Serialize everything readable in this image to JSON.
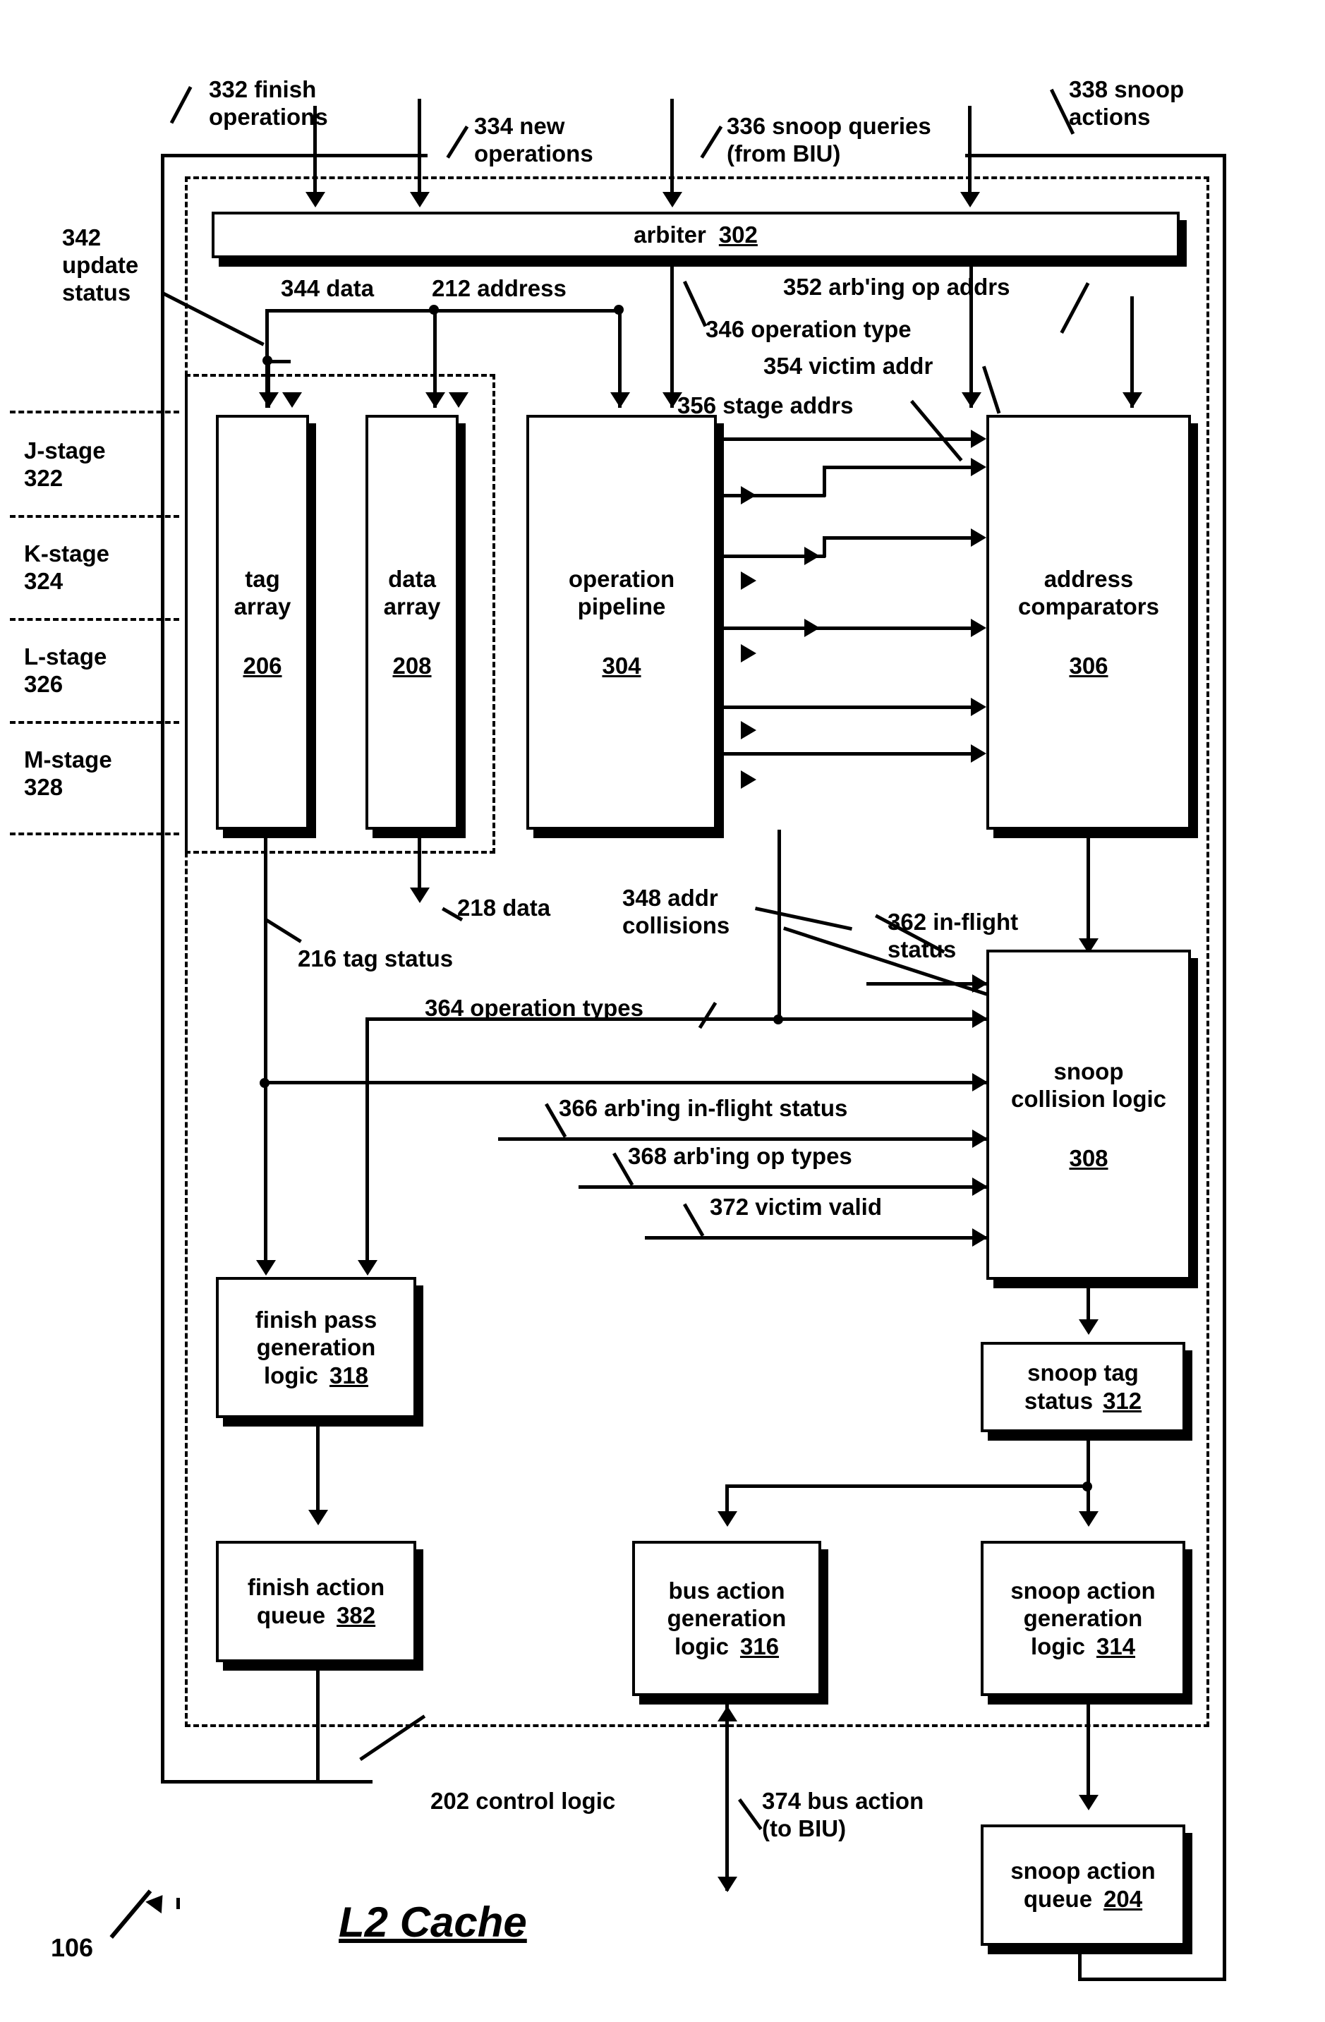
{
  "figure": {
    "title": "L2 Cache",
    "ref_number": "106"
  },
  "top_labels": [
    {
      "id": "finish_ops",
      "text": "332 finish\noperations"
    },
    {
      "id": "new_ops",
      "text": "334 new\noperations"
    },
    {
      "id": "snoop_queries",
      "text": "336 snoop queries\n(from BIU)"
    },
    {
      "id": "snoop_actions",
      "text": "338 snoop\nactions"
    }
  ],
  "signal_labels": [
    {
      "id": "update_status",
      "text": "342\nupdate\nstatus"
    },
    {
      "id": "data_344",
      "text": "344 data"
    },
    {
      "id": "address_212",
      "text": "212 address"
    },
    {
      "id": "arbing_op_addrs",
      "text": "352 arb'ing op addrs"
    },
    {
      "id": "operation_type",
      "text": "346 operation type"
    },
    {
      "id": "victim_addr",
      "text": "354 victim addr"
    },
    {
      "id": "stage_addrs",
      "text": "356 stage addrs"
    },
    {
      "id": "data_218",
      "text": "218 data"
    },
    {
      "id": "addr_collisions",
      "text": "348 addr\ncollisions"
    },
    {
      "id": "in_flight_status",
      "text": "362 in-flight\nstatus"
    },
    {
      "id": "tag_status",
      "text": "216 tag status"
    },
    {
      "id": "operation_types",
      "text": "364 operation types"
    },
    {
      "id": "arbing_in_flight",
      "text": "366 arb'ing in-flight status"
    },
    {
      "id": "arbing_op_types",
      "text": "368 arb'ing op types"
    },
    {
      "id": "victim_valid",
      "text": "372 victim valid"
    },
    {
      "id": "control_logic",
      "text": "202 control logic"
    },
    {
      "id": "bus_action",
      "text": "374 bus action\n(to BIU)"
    }
  ],
  "stages": [
    {
      "id": "j",
      "text": "J-stage\n322"
    },
    {
      "id": "k",
      "text": "K-stage\n324"
    },
    {
      "id": "l",
      "text": "L-stage\n326"
    },
    {
      "id": "m",
      "text": "M-stage\n328"
    }
  ],
  "blocks": [
    {
      "id": "arbiter",
      "label": "arbiter",
      "num": "302"
    },
    {
      "id": "tag_array",
      "label": "tag\narray",
      "num": "206"
    },
    {
      "id": "data_array",
      "label": "data\narray",
      "num": "208"
    },
    {
      "id": "operation_pipeline",
      "label": "operation\npipeline",
      "num": "304"
    },
    {
      "id": "address_comparators",
      "label": "address\ncomparators",
      "num": "306"
    },
    {
      "id": "snoop_collision_logic",
      "label": "snoop\ncollision logic",
      "num": "308"
    },
    {
      "id": "snoop_tag_status",
      "label": "snoop tag\nstatus",
      "num": "312"
    },
    {
      "id": "finish_pass_generation_logic",
      "label": "finish pass\ngeneration\nlogic",
      "num": "318"
    },
    {
      "id": "finish_action_queue",
      "label": "finish action\nqueue",
      "num": "382"
    },
    {
      "id": "bus_action_generation_logic",
      "label": "bus action\ngeneration\nlogic",
      "num": "316"
    },
    {
      "id": "snoop_action_generation_logic",
      "label": "snoop action\ngeneration\nlogic",
      "num": "314"
    },
    {
      "id": "snoop_action_queue",
      "label": "snoop action\nqueue",
      "num": "204"
    }
  ]
}
